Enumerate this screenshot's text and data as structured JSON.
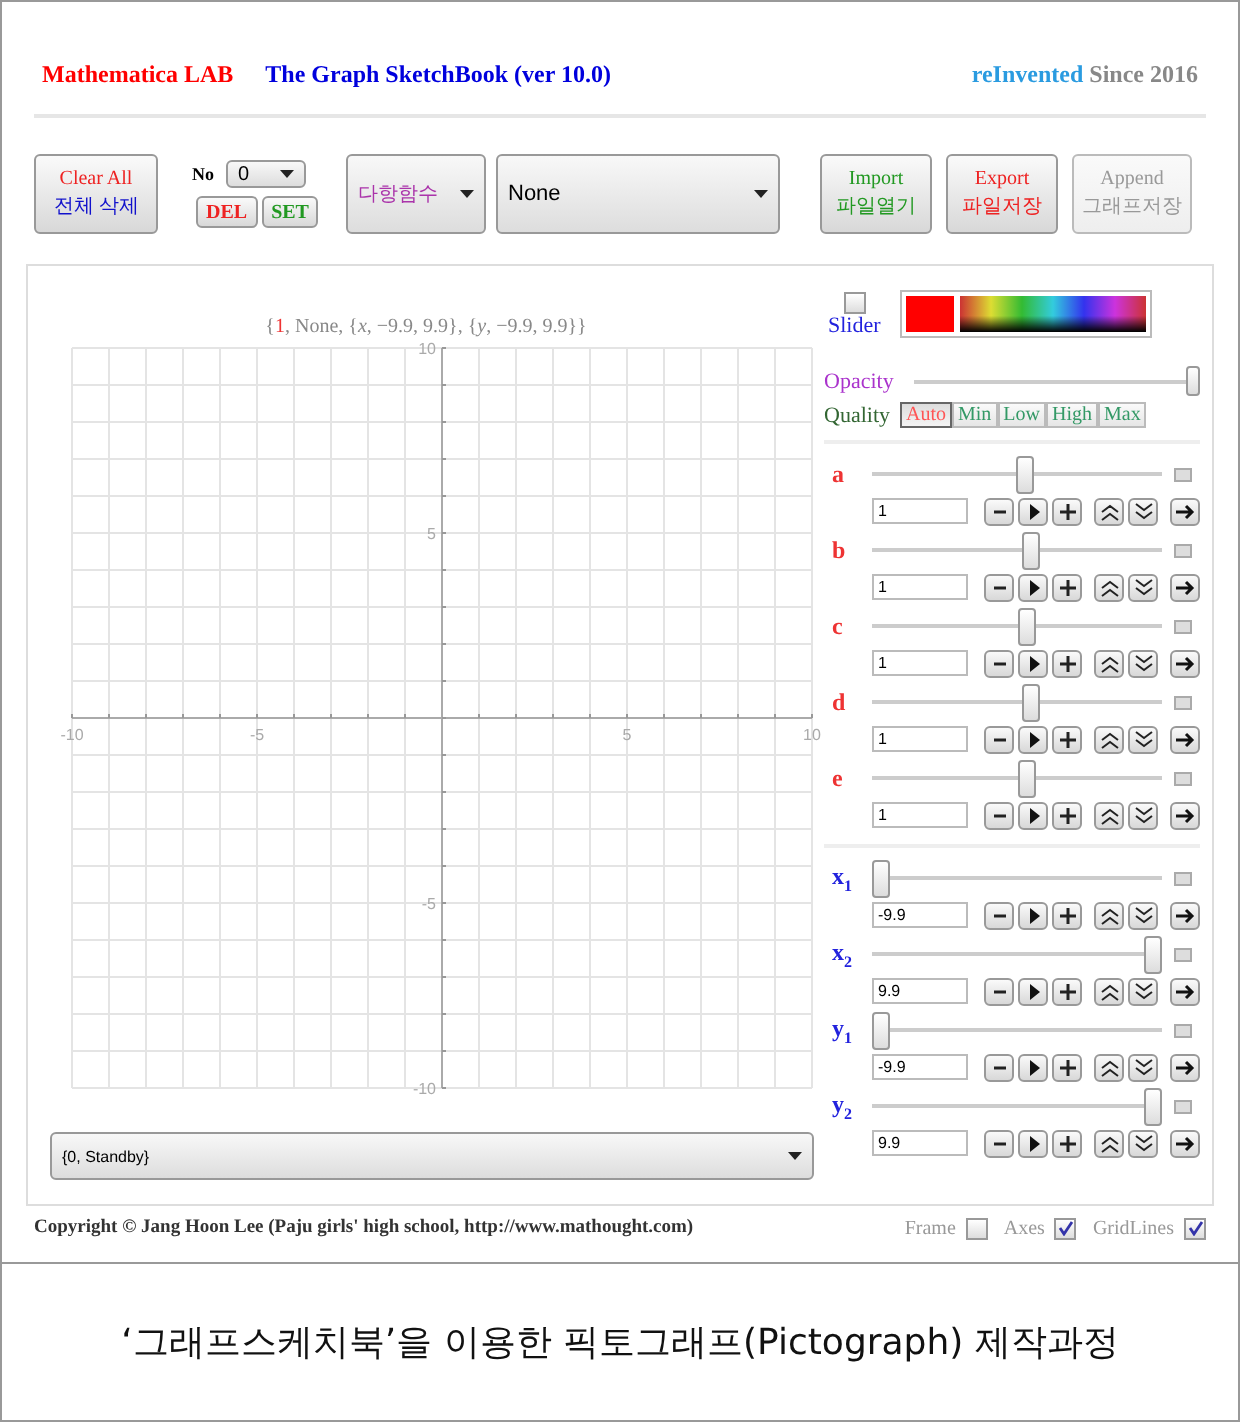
{
  "header": {
    "app_name": "Mathematica LAB",
    "title": "The Graph SketchBook (ver 10.0)",
    "tag_highlight": "reInvented",
    "tag_rest": "Since 2016"
  },
  "toolbar": {
    "clear_button": {
      "line1": "Clear All",
      "line2": "전체 삭제"
    },
    "number": {
      "label": "No",
      "value": "0"
    },
    "del_button": "DEL",
    "set_button": "SET",
    "function_type": "다항함수",
    "function": "None",
    "file_buttons": [
      {
        "kind": "import",
        "line1": "Import",
        "line2": "파일열기",
        "disabled": false
      },
      {
        "kind": "export",
        "line1": "Export",
        "line2": "파일저장",
        "disabled": false
      },
      {
        "kind": "append",
        "line1": "Append",
        "line2": "그래프저장",
        "disabled": true
      }
    ]
  },
  "plot": {
    "label": {
      "open": "{",
      "index": "1",
      "rest": ", None, {*x*, −9.9, 9.9}, {*y*, −9.9, 9.9}}"
    },
    "x_ticks": [
      "-10",
      "-5",
      "5",
      "10"
    ],
    "y_ticks": [
      "10",
      "5",
      "-5",
      "-10"
    ]
  },
  "status_dropdown": "{0, Standby}",
  "controls": {
    "slider_toggle": {
      "label": "Slider",
      "checked": false
    },
    "color": "#ff0000",
    "opacity": {
      "label": "Opacity",
      "level": 1
    },
    "quality": {
      "label": "Quality",
      "options": [
        {
          "label": "Auto",
          "selected": true
        },
        {
          "label": "Min",
          "selected": false
        },
        {
          "label": "Low",
          "selected": false
        },
        {
          "label": "High",
          "selected": false
        },
        {
          "label": "Max",
          "selected": false
        }
      ]
    }
  },
  "parameters": [
    {
      "name": "a",
      "value": "1",
      "level": 0.53
    },
    {
      "name": "b",
      "value": "1",
      "level": 0.55
    },
    {
      "name": "c",
      "value": "1",
      "level": 0.54
    },
    {
      "name": "d",
      "value": "1",
      "level": 0.55
    },
    {
      "name": "e",
      "value": "1",
      "level": 0.54
    }
  ],
  "ranges": [
    {
      "name": "x$_{1}$",
      "value": "-9.9",
      "level": 0
    },
    {
      "name": "x$_{2}$",
      "value": "9.9",
      "level": 1
    },
    {
      "name": "y$_{1}$",
      "value": "-9.9",
      "level": 0
    },
    {
      "name": "y$_{2}$",
      "value": "9.9",
      "level": 1
    }
  ],
  "footer": {
    "copyright": "Copyright © Jang Hoon Lee (Paju girls' high school, http://www.mathought.com)",
    "options": [
      {
        "label": "Frame",
        "checked": false
      },
      {
        "label": "Axes",
        "checked": true
      },
      {
        "label": "GridLines",
        "checked": true
      }
    ]
  },
  "caption": "‘그래프스케치북’을 이용한 픽토그래프(Pictograph) 제작과정"
}
